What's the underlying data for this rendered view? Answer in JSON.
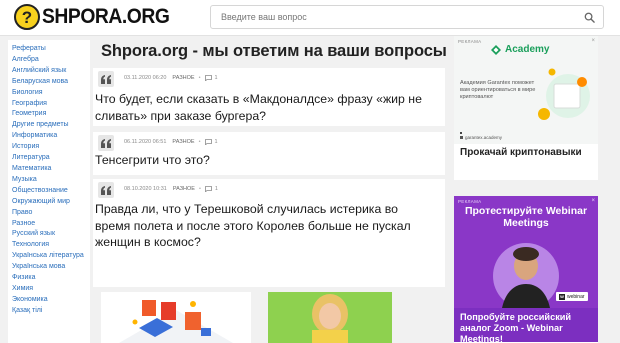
{
  "header": {
    "logo_letter": "?",
    "logo_text": "SHPORA.ORG",
    "search_placeholder": "Введите ваш вопрос"
  },
  "sidebar": {
    "items": [
      {
        "label": "Рефераты"
      },
      {
        "label": "Алгебра"
      },
      {
        "label": "Английский язык"
      },
      {
        "label": "Беларуская мова"
      },
      {
        "label": "Биология"
      },
      {
        "label": "География"
      },
      {
        "label": "Геометрия"
      },
      {
        "label": "Другие предметы"
      },
      {
        "label": "Информатика"
      },
      {
        "label": "История"
      },
      {
        "label": "Литература"
      },
      {
        "label": "Математика"
      },
      {
        "label": "Музыка"
      },
      {
        "label": "Обществознание"
      },
      {
        "label": "Окружающий мир"
      },
      {
        "label": "Право"
      },
      {
        "label": "Разное"
      },
      {
        "label": "Русский язык"
      },
      {
        "label": "Технология"
      },
      {
        "label": "Українська література"
      },
      {
        "label": "Українська мова"
      },
      {
        "label": "Физика"
      },
      {
        "label": "Химия"
      },
      {
        "label": "Экономика"
      },
      {
        "label": "Қазақ тiлi"
      }
    ]
  },
  "main": {
    "title": "Shpora.org - мы ответим на ваши вопросы",
    "questions": [
      {
        "date": "03.11.2020 06:20",
        "category": "РАЗНОЕ",
        "comments": "1",
        "title": "Что будет, если сказать в «Макдоналдсе» фразу «жир не сливать» при заказе бургера?"
      },
      {
        "date": "06.11.2020 06:51",
        "category": "РАЗНОЕ",
        "comments": "1",
        "title": "Тенсегрити что это?"
      },
      {
        "date": "08.10.2020 10:31",
        "category": "РАЗНОЕ",
        "comments": "1",
        "title": "Правда ли, что у Терешковой случилась истерика во время полета и после этого Королев больше не пускал женщин в космос?"
      }
    ]
  },
  "ads": {
    "label": "РЕКЛАМА",
    "ad1": {
      "brand": "Academy",
      "subtitle": "Академия Garantex поможет вам ориентироваться в мире криптовалют",
      "caption": "garantex.academy",
      "text": "Прокачай криптонавыки"
    },
    "ad2": {
      "headline": "Протестируйте Webinar Meetings",
      "badge": "webinar",
      "body": "Попробуйте российский аналог Zoom - Webinar Meetings!"
    }
  },
  "colors": {
    "link": "#2a6ebb",
    "logo_yellow": "#f7d11e",
    "ad_purple": "#8a37c7",
    "ad_green": "#1a9f5b"
  }
}
